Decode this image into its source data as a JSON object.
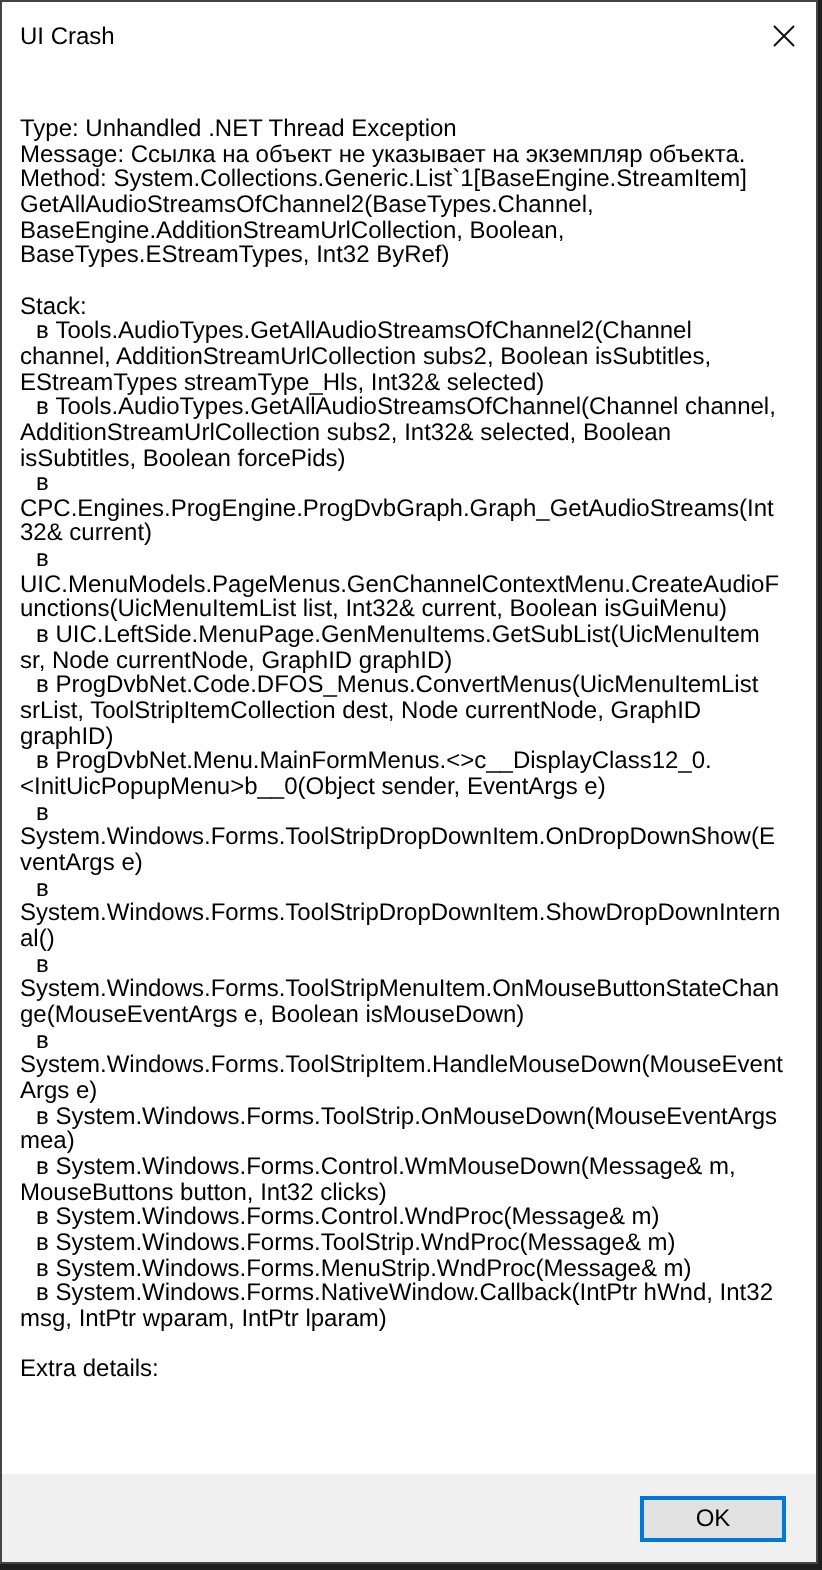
{
  "window": {
    "title": "UI Crash"
  },
  "report": {
    "type": "Type: Unhandled .NET Thread Exception",
    "message": "Message: Ссылка на объект не указывает на экземпляр объекта.",
    "method": "Method: System.Collections.Generic.List`1[BaseEngine.StreamItem] GetAllAudioStreamsOfChannel2(BaseTypes.Channel, BaseEngine.AdditionStreamUrlCollection, Boolean, BaseTypes.EStreamTypes, Int32 ByRef)",
    "stack_label": "Stack:",
    "stack": [
      "в Tools.AudioTypes.GetAllAudioStreamsOfChannel2(Channel channel, AdditionStreamUrlCollection subs2, Boolean isSubtitles, EStreamTypes streamType_Hls, Int32& selected)",
      "в Tools.AudioTypes.GetAllAudioStreamsOfChannel(Channel channel, AdditionStreamUrlCollection subs2, Int32& selected, Boolean isSubtitles, Boolean forcePids)",
      "в CPC.Engines.ProgEngine.ProgDvbGraph.Graph_GetAudioStreams(Int32& current)",
      "в UIC.MenuModels.PageMenus.GenChannelContextMenu.CreateAudioFunctions(UicMenuItemList list, Int32& current, Boolean isGuiMenu)",
      "в UIC.LeftSide.MenuPage.GenMenuItems.GetSubList(UicMenuItem sr, Node currentNode, GraphID graphID)",
      "в ProgDvbNet.Code.DFOS_Menus.ConvertMenus(UicMenuItemList srList, ToolStripItemCollection dest, Node currentNode, GraphID graphID)",
      "в ProgDvbNet.Menu.MainFormMenus.<>c__DisplayClass12_0.<InitUicPopupMenu>b__0(Object sender, EventArgs e)",
      "в System.Windows.Forms.ToolStripDropDownItem.OnDropDownShow(EventArgs e)",
      "в System.Windows.Forms.ToolStripDropDownItem.ShowDropDownInternal()",
      "в System.Windows.Forms.ToolStripMenuItem.OnMouseButtonStateChange(MouseEventArgs e, Boolean isMouseDown)",
      "в System.Windows.Forms.ToolStripItem.HandleMouseDown(MouseEventArgs e)",
      "в System.Windows.Forms.ToolStrip.OnMouseDown(MouseEventArgs mea)",
      "в System.Windows.Forms.Control.WmMouseDown(Message& m, MouseButtons button, Int32 clicks)",
      "в System.Windows.Forms.Control.WndProc(Message& m)",
      "в System.Windows.Forms.ToolStrip.WndProc(Message& m)",
      "в System.Windows.Forms.MenuStrip.WndProc(Message& m)",
      "в System.Windows.Forms.NativeWindow.Callback(IntPtr hWnd, Int32 msg, IntPtr wparam, IntPtr lparam)"
    ],
    "extra_details": "Extra details:"
  },
  "buttons": [
    {
      "label": "OK",
      "selected": true
    }
  ]
}
